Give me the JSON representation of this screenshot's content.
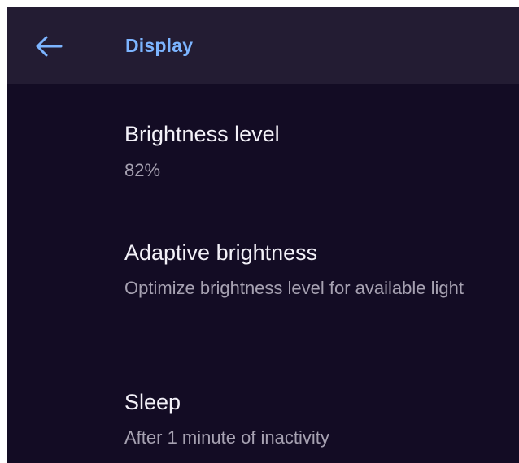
{
  "app_bar": {
    "back_icon": "arrow-left-icon",
    "title": "Display"
  },
  "settings": [
    {
      "title": "Brightness level",
      "summary": "82%"
    },
    {
      "title": "Adaptive brightness",
      "summary": "Optimize brightness level for available light"
    },
    {
      "title": "Sleep",
      "summary": "After 1 minute of inactivity"
    }
  ],
  "colors": {
    "background": "#130c24",
    "app_bar": "#231c33",
    "accent": "#7cb4ff",
    "primary_text": "#f3f1f8",
    "secondary_text": "#a6a1b1"
  }
}
